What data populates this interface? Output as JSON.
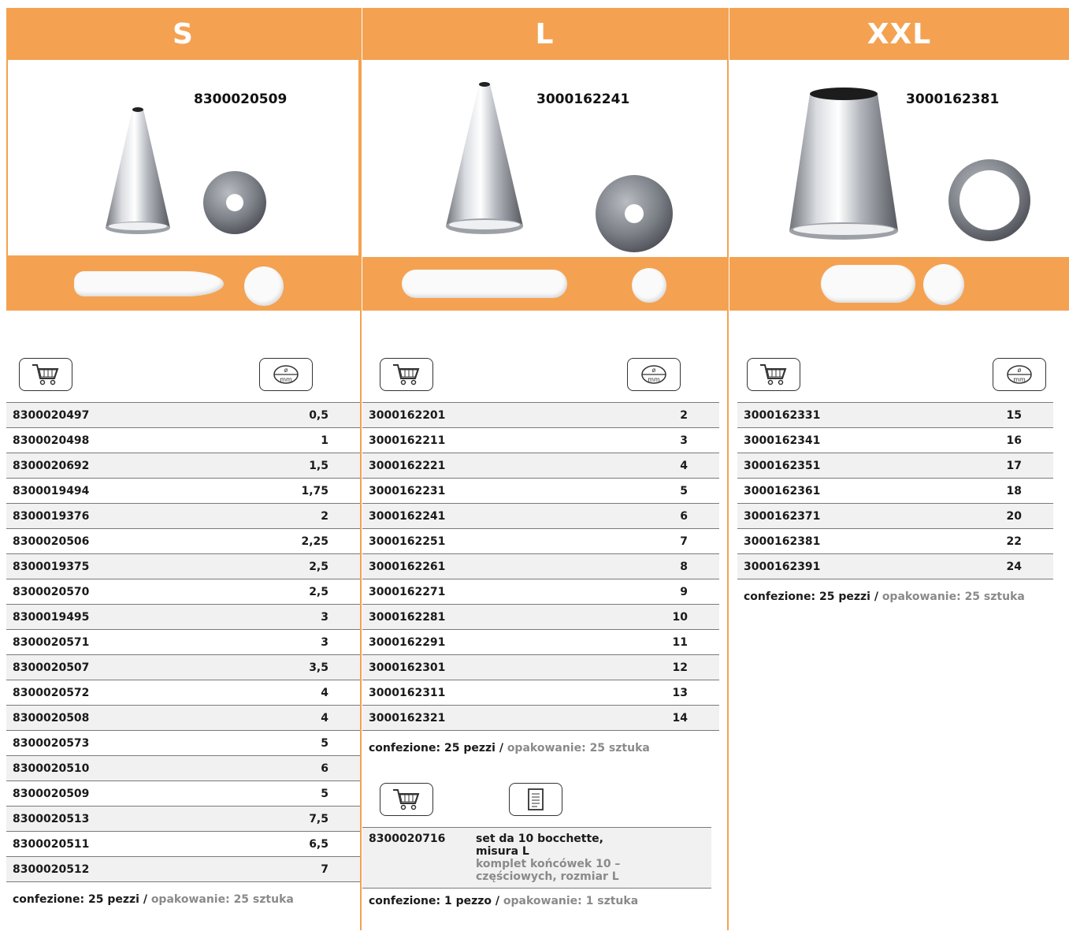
{
  "columns": {
    "s": {
      "size": "S",
      "photo_code": "8300020509",
      "rows": [
        {
          "code": "8300020497",
          "mm": "0,5"
        },
        {
          "code": "8300020498",
          "mm": "1"
        },
        {
          "code": "8300020692",
          "mm": "1,5"
        },
        {
          "code": "8300019494",
          "mm": "1,75"
        },
        {
          "code": "8300019376",
          "mm": "2"
        },
        {
          "code": "8300020506",
          "mm": "2,25"
        },
        {
          "code": "8300019375",
          "mm": "2,5"
        },
        {
          "code": "8300020570",
          "mm": "2,5"
        },
        {
          "code": "8300019495",
          "mm": "3"
        },
        {
          "code": "8300020571",
          "mm": "3"
        },
        {
          "code": "8300020507",
          "mm": "3,5"
        },
        {
          "code": "8300020572",
          "mm": "4"
        },
        {
          "code": "8300020508",
          "mm": "4"
        },
        {
          "code": "8300020573",
          "mm": "5"
        },
        {
          "code": "8300020510",
          "mm": "6"
        },
        {
          "code": "8300020509",
          "mm": "5"
        },
        {
          "code": "8300020513",
          "mm": "7,5"
        },
        {
          "code": "8300020511",
          "mm": "6,5"
        },
        {
          "code": "8300020512",
          "mm": "7"
        }
      ],
      "pack_it": "confezione: 25 pezzi /",
      "pack_pl": "opakowanie: 25 sztuka"
    },
    "l": {
      "size": "L",
      "photo_code": "3000162241",
      "rows": [
        {
          "code": "3000162201",
          "mm": "2"
        },
        {
          "code": "3000162211",
          "mm": "3"
        },
        {
          "code": "3000162221",
          "mm": "4"
        },
        {
          "code": "3000162231",
          "mm": "5"
        },
        {
          "code": "3000162241",
          "mm": "6"
        },
        {
          "code": "3000162251",
          "mm": "7"
        },
        {
          "code": "3000162261",
          "mm": "8"
        },
        {
          "code": "3000162271",
          "mm": "9"
        },
        {
          "code": "3000162281",
          "mm": "10"
        },
        {
          "code": "3000162291",
          "mm": "11"
        },
        {
          "code": "3000162301",
          "mm": "12"
        },
        {
          "code": "3000162311",
          "mm": "13"
        },
        {
          "code": "3000162321",
          "mm": "14"
        }
      ],
      "pack_it": "confezione: 25 pezzi /",
      "pack_pl": "opakowanie: 25 sztuka",
      "set": {
        "code": "8300020716",
        "desc_it_1": "set da 10 bocchette,",
        "desc_it_2": "misura L",
        "desc_pl_1": "komplet końcówek 10 –",
        "desc_pl_2": "częściowych, rozmiar L"
      },
      "set_pack_it": "confezione: 1 pezzo /",
      "set_pack_pl": "opakowanie: 1 sztuka"
    },
    "xxl": {
      "size": "XXL",
      "photo_code": "3000162381",
      "rows": [
        {
          "code": "3000162331",
          "mm": "15"
        },
        {
          "code": "3000162341",
          "mm": "16"
        },
        {
          "code": "3000162351",
          "mm": "17"
        },
        {
          "code": "3000162361",
          "mm": "18"
        },
        {
          "code": "3000162371",
          "mm": "20"
        },
        {
          "code": "3000162381",
          "mm": "22"
        },
        {
          "code": "3000162391",
          "mm": "24"
        }
      ],
      "pack_it": "confezione: 25 pezzi /",
      "pack_pl": "opakowanie: 25 sztuka"
    }
  },
  "icons": {
    "cart": "shopping-cart-icon",
    "diameter": "diameter-mm-icon",
    "document": "document-icon",
    "diameter_symbol": "ø",
    "diameter_unit": "mm"
  },
  "colors": {
    "accent": "#f4a251",
    "row_alt": "#f1f1f1",
    "muted_text": "#8a8a8a"
  }
}
